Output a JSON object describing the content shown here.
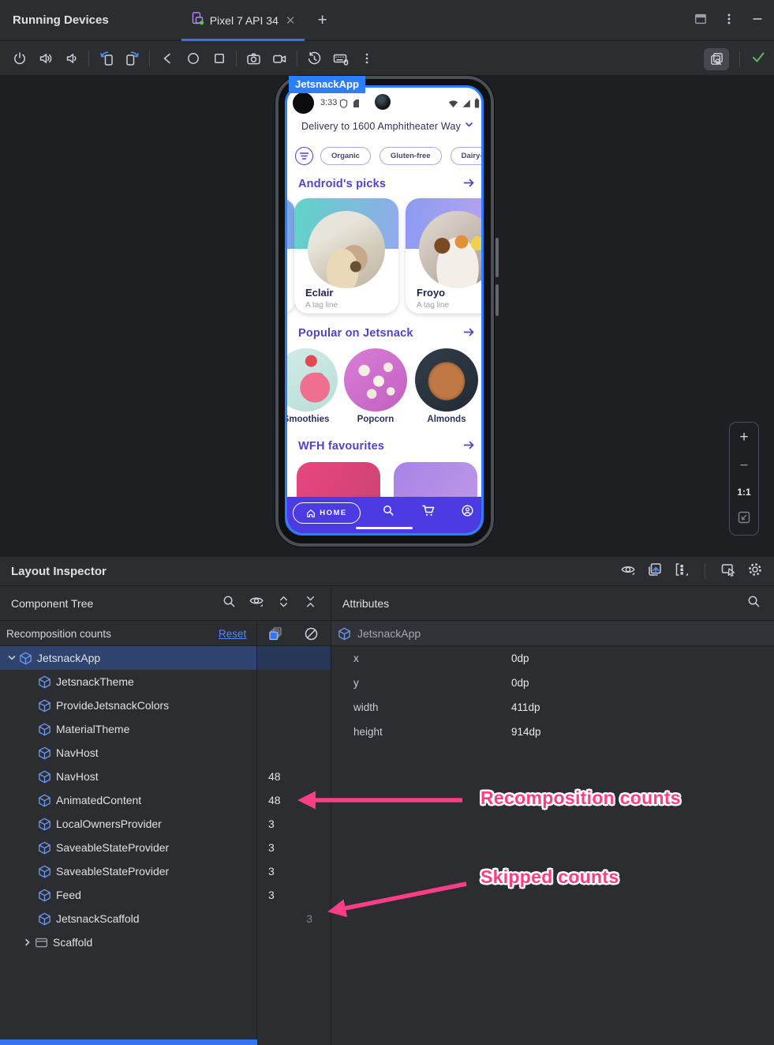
{
  "colors": {
    "accent_blue": "#3574F0",
    "link_blue": "#548AF7",
    "selection_blue": "#2E436E",
    "annotation_pink": "#FB3E85",
    "check_green": "#5FAD65",
    "jetsnack_purple": "#5242C8",
    "jetsnack_nav_blue": "#4C3AE3",
    "highlight_border_blue": "#2B7FFF"
  },
  "tabbar": {
    "window_title": "Running Devices",
    "device_tab_label": "Pixel 7 API 34",
    "close_glyph": "✕",
    "plus_glyph": "+"
  },
  "device": {
    "overlay_label": "JetsnackApp",
    "status_time": "3:33",
    "delivery_text": "Delivery to 1600 Amphitheater Way",
    "chips": [
      "Organic",
      "Gluten-free",
      "Dairy-free"
    ],
    "picks": {
      "title": "Android's picks",
      "items": [
        {
          "name": "Eclair",
          "tagline": "A tag line"
        },
        {
          "name": "Froyo",
          "tagline": "A tag line"
        }
      ]
    },
    "popular": {
      "title": "Popular on Jetsnack",
      "items": [
        "Smoothies",
        "Popcorn",
        "Almonds"
      ]
    },
    "wfh": {
      "title": "WFH favourites"
    },
    "nav_home_label": "HOME"
  },
  "zoom_controls": {
    "zoom_in": "+",
    "zoom_out": "−",
    "actual_size": "1:1"
  },
  "inspector": {
    "title": "Layout Inspector",
    "tree_panel": {
      "title": "Component Tree",
      "counts_label": "Recomposition counts",
      "reset_label": "Reset",
      "rows": [
        {
          "label": "JetsnackApp",
          "count": "",
          "skipped": ""
        },
        {
          "label": "JetsnackTheme",
          "count": "",
          "skipped": ""
        },
        {
          "label": "ProvideJetsnackColors",
          "count": "",
          "skipped": ""
        },
        {
          "label": "MaterialTheme",
          "count": "",
          "skipped": ""
        },
        {
          "label": "NavHost",
          "count": "",
          "skipped": ""
        },
        {
          "label": "NavHost",
          "count": "48",
          "skipped": ""
        },
        {
          "label": "AnimatedContent",
          "count": "48",
          "skipped": ""
        },
        {
          "label": "LocalOwnersProvider",
          "count": "3",
          "skipped": ""
        },
        {
          "label": "SaveableStateProvider",
          "count": "3",
          "skipped": ""
        },
        {
          "label": "SaveableStateProvider",
          "count": "3",
          "skipped": ""
        },
        {
          "label": "Feed",
          "count": "3",
          "skipped": ""
        },
        {
          "label": "JetsnackScaffold",
          "count": "",
          "skipped": "3"
        },
        {
          "label": "Scaffold",
          "count": "",
          "skipped": ""
        }
      ]
    },
    "attributes_panel": {
      "title": "Attributes",
      "component": "JetsnackApp",
      "props": [
        {
          "name": "x",
          "value": "0dp"
        },
        {
          "name": "y",
          "value": "0dp"
        },
        {
          "name": "width",
          "value": "411dp"
        },
        {
          "name": "height",
          "value": "914dp"
        }
      ]
    },
    "annotations": {
      "recomposition": "Recomposition counts",
      "skipped": "Skipped counts"
    }
  }
}
